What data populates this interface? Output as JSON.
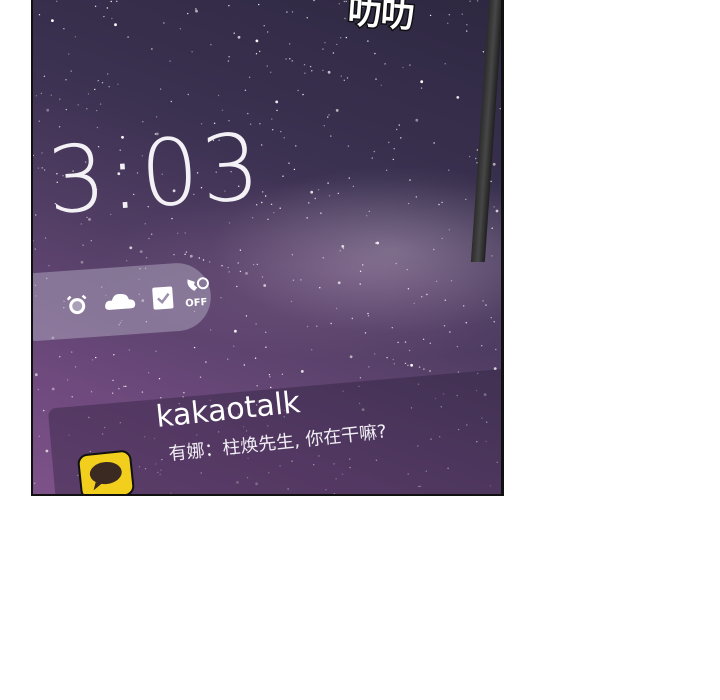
{
  "sound_effect": "叻叻",
  "lock_screen": {
    "time": "3:03",
    "status_icons": [
      "alarm-icon",
      "cloud-icon",
      "task-check-icon",
      "call-off-icon"
    ],
    "call_off_label": "OFF"
  },
  "notification": {
    "app_name": "kakaotalk",
    "app_icon": "kakaotalk-icon",
    "message": "有娜：柱焕先生, 你在干嘛?"
  },
  "colors": {
    "sky_dark": "#2e2841",
    "sky_purple": "#7d5289",
    "kakao_yellow": "#f2cf1d",
    "pill": "#aaa0b9"
  }
}
